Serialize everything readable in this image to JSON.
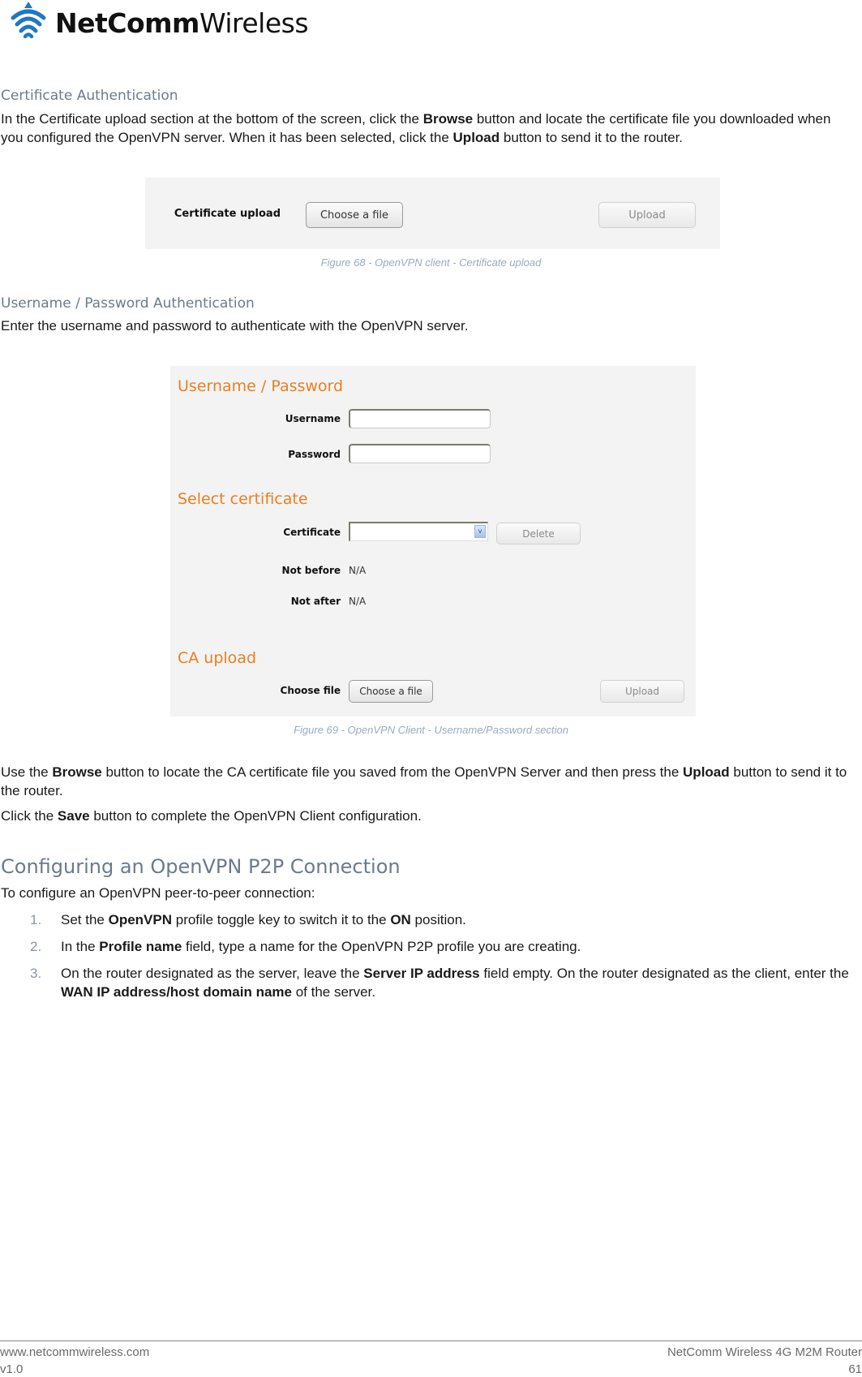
{
  "brand": {
    "bold": "NetComm",
    "light": "Wireless",
    "logo_icon": "wifi-signal-icon",
    "colors": {
      "logo_blue": "#1f78c1",
      "heading_gray": "#6b7a8f",
      "orange": "#e8801e",
      "caption": "#9aaac0"
    }
  },
  "section_cert": {
    "heading": "Certificate Authentication",
    "para": [
      {
        "t": "In the Certificate upload section at the bottom of the screen, click the "
      },
      {
        "b": "Browse"
      },
      {
        "t": " button and locate the certificate file you downloaded when you configured the OpenVPN server. When it has been selected, click the "
      },
      {
        "b": "Upload"
      },
      {
        "t": " button to send it to the router."
      }
    ]
  },
  "figure68": {
    "label": "Certificate upload",
    "choose_button": "Choose a file",
    "upload_button": "Upload",
    "caption": "Figure 68 - OpenVPN client - Certificate upload"
  },
  "section_userpass": {
    "heading": "Username / Password Authentication",
    "para": "Enter the username and password to authenticate with the OpenVPN server."
  },
  "figure69": {
    "userpass_title": "Username / Password",
    "username_label": "Username",
    "username_value": "",
    "password_label": "Password",
    "password_value": "",
    "select_title": "Select certificate",
    "certificate_label": "Certificate",
    "certificate_selected": "",
    "delete_button": "Delete",
    "not_before_label": "Not before",
    "not_before_value": "N/A",
    "not_after_label": "Not after",
    "not_after_value": "N/A",
    "ca_title": "CA upload",
    "choose_file_label": "Choose file",
    "choose_button": "Choose a file",
    "upload_button": "Upload",
    "caption": "Figure 69 - OpenVPN Client - Username/Password section"
  },
  "after_fig": {
    "para1": [
      {
        "t": "Use the "
      },
      {
        "b": "Browse"
      },
      {
        "t": " button to locate the CA certificate file you saved from the OpenVPN Server and then press the "
      },
      {
        "b": "Upload"
      },
      {
        "t": " button to send it to the router."
      }
    ],
    "para2": [
      {
        "t": "Click the "
      },
      {
        "b": "Save"
      },
      {
        "t": " button to complete the OpenVPN Client configuration."
      }
    ]
  },
  "section_p2p": {
    "heading": "Configuring an OpenVPN P2P Connection",
    "intro": "To configure an OpenVPN peer-to-peer connection:",
    "steps": [
      {
        "num": "1.",
        "parts": [
          {
            "t": "Set the "
          },
          {
            "b": "OpenVPN"
          },
          {
            "t": " profile toggle key to switch it to the "
          },
          {
            "b": "ON"
          },
          {
            "t": " position."
          }
        ]
      },
      {
        "num": "2.",
        "parts": [
          {
            "t": "In the "
          },
          {
            "b": "Profile name"
          },
          {
            "t": " field, type a name for the OpenVPN P2P profile you are creating."
          }
        ]
      },
      {
        "num": "3.",
        "parts": [
          {
            "t": "On the router designated as the server, leave the "
          },
          {
            "b": "Server IP address"
          },
          {
            "t": " field empty. On the router designated as the client, enter the "
          },
          {
            "b": "WAN IP address/host domain name"
          },
          {
            "t": " of the server."
          }
        ]
      }
    ]
  },
  "footer": {
    "website": "www.netcommwireless.com",
    "version": "v1.0",
    "product": "NetComm Wireless 4G M2M Router",
    "page": "61"
  }
}
